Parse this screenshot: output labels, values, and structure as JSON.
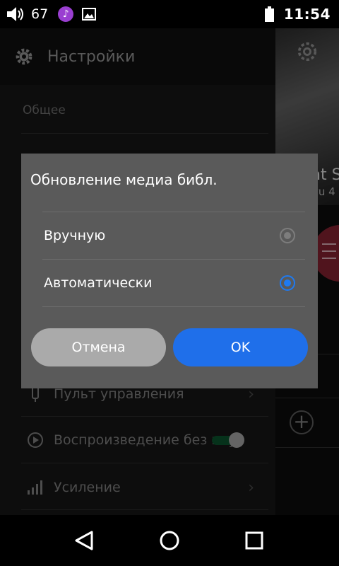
{
  "status_bar": {
    "volume_level": "67",
    "time": "11:54",
    "icons": [
      "volume-icon",
      "music-app-icon",
      "image-icon",
      "battery-icon"
    ],
    "music_glyph": "♪"
  },
  "drawer": {
    "title": "Настройки",
    "section": "Общее",
    "rows": [
      {
        "label": "Пульт управления"
      },
      {
        "label": "Воспроизведение без пауз"
      },
      {
        "label": "Усиление"
      }
    ]
  },
  "right_panel": {
    "album_text": "ht S",
    "album_sub": "vu 4",
    "plus": "+"
  },
  "dialog": {
    "title": "Обновление медиа библ.",
    "options": [
      {
        "label": "Вручную",
        "selected": false
      },
      {
        "label": "Автоматически",
        "selected": true
      }
    ],
    "cancel_label": "Отмена",
    "ok_label": "OK"
  },
  "colors": {
    "accent": "#1f6fea",
    "dialog_bg": "#5a5a5a",
    "cancel_bg": "#aaaaaa"
  }
}
